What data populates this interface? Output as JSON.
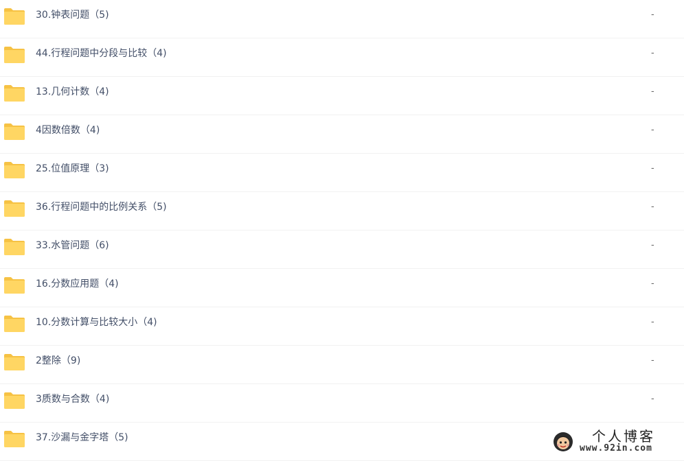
{
  "files": [
    {
      "name": "30.钟表问题（5)",
      "size": "-"
    },
    {
      "name": "44.行程问题中分段与比较（4)",
      "size": "-"
    },
    {
      "name": "13.几何计数（4)",
      "size": "-"
    },
    {
      "name": "4因数倍数（4)",
      "size": "-"
    },
    {
      "name": "25.位值原理（3)",
      "size": "-"
    },
    {
      "name": "36.行程问题中的比例关系（5)",
      "size": "-"
    },
    {
      "name": "33.水管问题（6)",
      "size": "-"
    },
    {
      "name": "16.分数应用题（4)",
      "size": "-"
    },
    {
      "name": "10.分数计算与比较大小（4)",
      "size": "-"
    },
    {
      "name": "2整除（9)",
      "size": "-"
    },
    {
      "name": "3质数与合数（4)",
      "size": "-"
    },
    {
      "name": "37.沙漏与金字塔（5)",
      "size": ""
    }
  ],
  "icons": {
    "folder": "folder-icon"
  },
  "colors": {
    "folder_body": "#ffd663",
    "folder_tab": "#f6c244",
    "text": "#424e67",
    "divider": "#f1f1f1"
  },
  "watermark": {
    "title": "个人博客",
    "url": "www.92in.com"
  }
}
